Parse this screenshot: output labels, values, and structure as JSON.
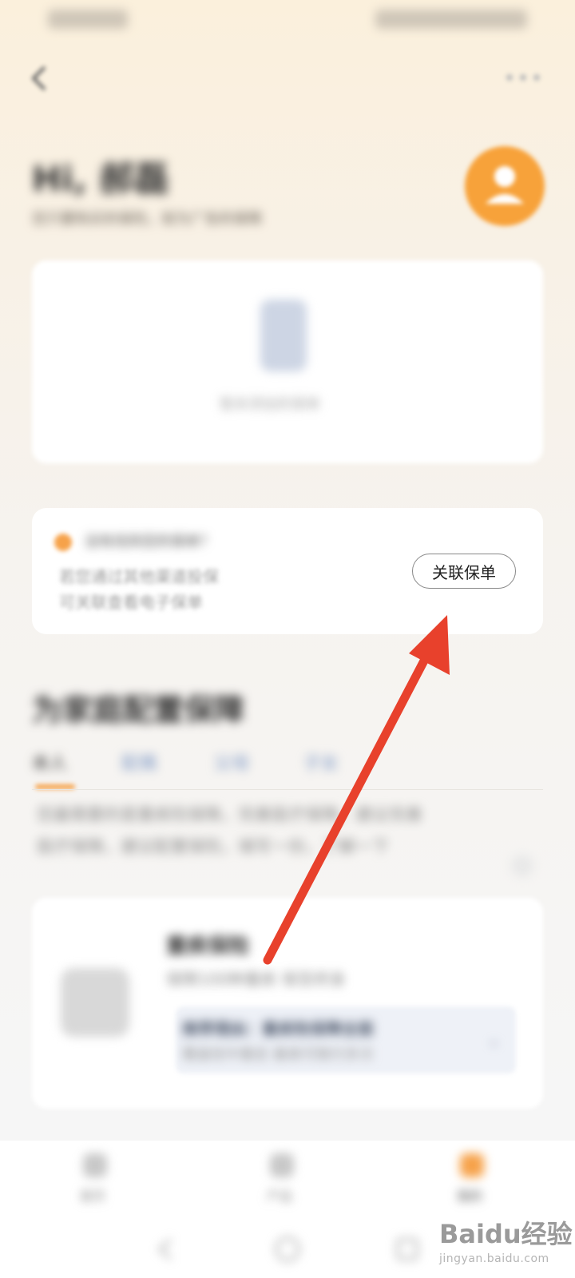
{
  "header": {
    "greeting": "Hi, 郝磊",
    "subtitle": "您只要购买的保险，就为广告的保障"
  },
  "policy_card": {
    "empty_text": "暂未添加的保单"
  },
  "link_card": {
    "tip_title": "没有找到您的保单？",
    "tip_line1": "若您通过其他渠道投保",
    "tip_line2": "可关联查看电子保单",
    "link_button": "关联保单"
  },
  "recommend": {
    "title": "为家庭配置保障",
    "tabs": [
      "本人",
      "配偶",
      "父母",
      "子女"
    ],
    "desc_line1": "您最需要的是重疾险保障，完善医疗保障，建议完善",
    "desc_line2": "医疗保障，建议配置保险，填写一份，了解一下"
  },
  "product": {
    "name": "重疾保险",
    "desc": "保障100种重疾 保至终身",
    "box_title": "推荐理由：重疾险保障全面",
    "box_sub": "覆盖轻中重症 最高可赔付多次"
  },
  "bottom_nav": {
    "items": [
      {
        "label": "首页",
        "icon": "home-icon"
      },
      {
        "label": "产品",
        "icon": "grid-icon"
      },
      {
        "label": "我的",
        "icon": "person-icon"
      }
    ]
  },
  "watermark": {
    "logo": "Baidu经验",
    "url": "jingyan.baidu.com"
  },
  "colors": {
    "accent": "#f6a24a",
    "arrow": "#e8412c",
    "avatar": "#f7a23a"
  }
}
